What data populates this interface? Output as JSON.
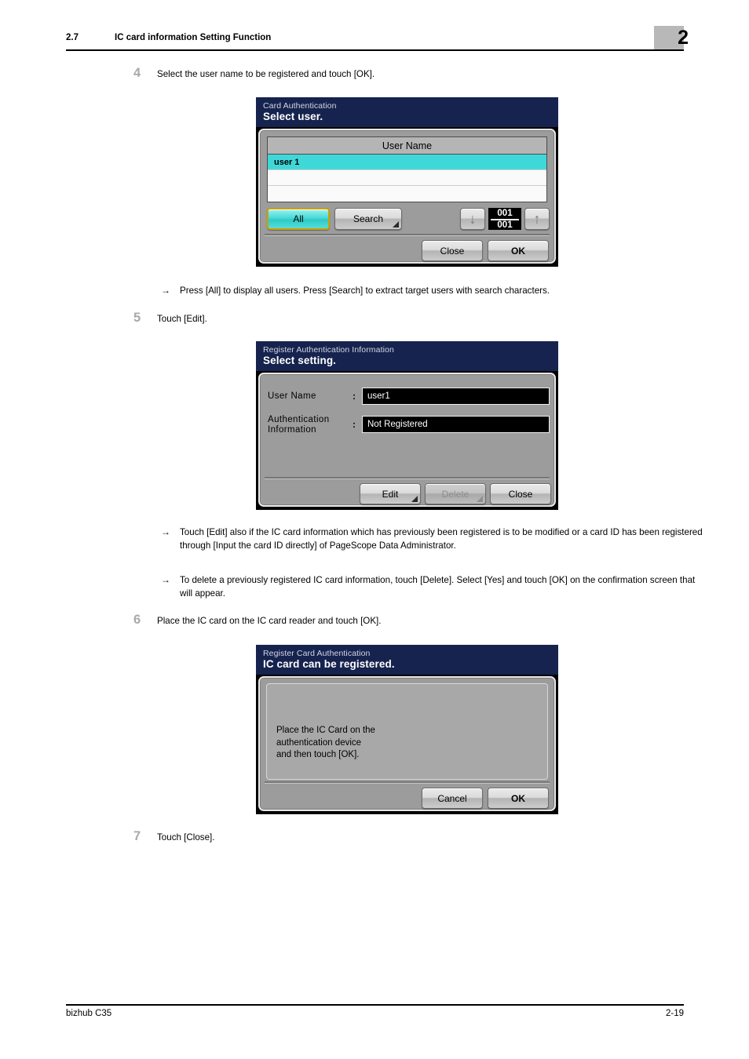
{
  "header": {
    "section_number": "2.7",
    "section_title": "IC card information Setting Function",
    "chapter_badge": "2"
  },
  "footer": {
    "product": "bizhub C35",
    "page_number": "2-19"
  },
  "steps": [
    {
      "number": "4",
      "text": "Select the user name to be registered and touch [OK]."
    },
    {
      "number": "5",
      "text": "Touch [Edit]."
    },
    {
      "number": "6",
      "text": "Place the IC card on the IC card reader and touch [OK]."
    },
    {
      "number": "7",
      "text": "Touch [Close]."
    }
  ],
  "notes": [
    {
      "arrow": "→",
      "text": "Press [All] to display all users. Press [Search] to extract target users with search characters."
    },
    {
      "arrow": "→",
      "text": "Touch [Edit] also if the IC card information which has previously been registered is to be modified or a card ID has been registered through [Input the card ID directly] of PageScope Data Administrator."
    },
    {
      "arrow": "→",
      "text": "To delete a previously registered IC card information, touch [Delete]. Select [Yes] and touch [OK] on the confirmation screen that will appear."
    }
  ],
  "dialog1": {
    "title_sub": "Card Authentication",
    "title_main": "Select user.",
    "column_header": "User Name",
    "rows": [
      {
        "value": "user 1",
        "selected": true
      },
      {
        "value": "",
        "selected": false
      },
      {
        "value": "",
        "selected": false
      }
    ],
    "all_button": "All",
    "search_button": "Search",
    "counter_top": "001",
    "counter_bottom": "001",
    "down_arrow": "↓",
    "up_arrow": "↑",
    "close_button": "Close",
    "ok_button": "OK"
  },
  "dialog2": {
    "title_sub": "Register Authentication Information",
    "title_main": "Select setting.",
    "fields": [
      {
        "label": "User Name",
        "separator": ":",
        "value": "user1"
      },
      {
        "label": "Authentication\nInformation",
        "separator": ":",
        "value": "Not Registered"
      }
    ],
    "edit_button": "Edit",
    "delete_button": "Delete",
    "close_button": "Close"
  },
  "dialog3": {
    "title_sub": "Register Card Authentication",
    "title_main": "IC card can be registered.",
    "message": "Place the IC Card on the\nauthentication device\nand then touch [OK].",
    "cancel_button": "Cancel",
    "ok_button": "OK"
  },
  "colors": {
    "panel_title_bg": "#16234e",
    "panel_body_bg": "#9c9c9c",
    "selection_teal": "#3fd8d8",
    "selected_button_border": "#c9a200",
    "field_value_bg": "#000000",
    "chapter_badge_bg": "#b8b8b8",
    "step_number": "#a9a9a9"
  }
}
